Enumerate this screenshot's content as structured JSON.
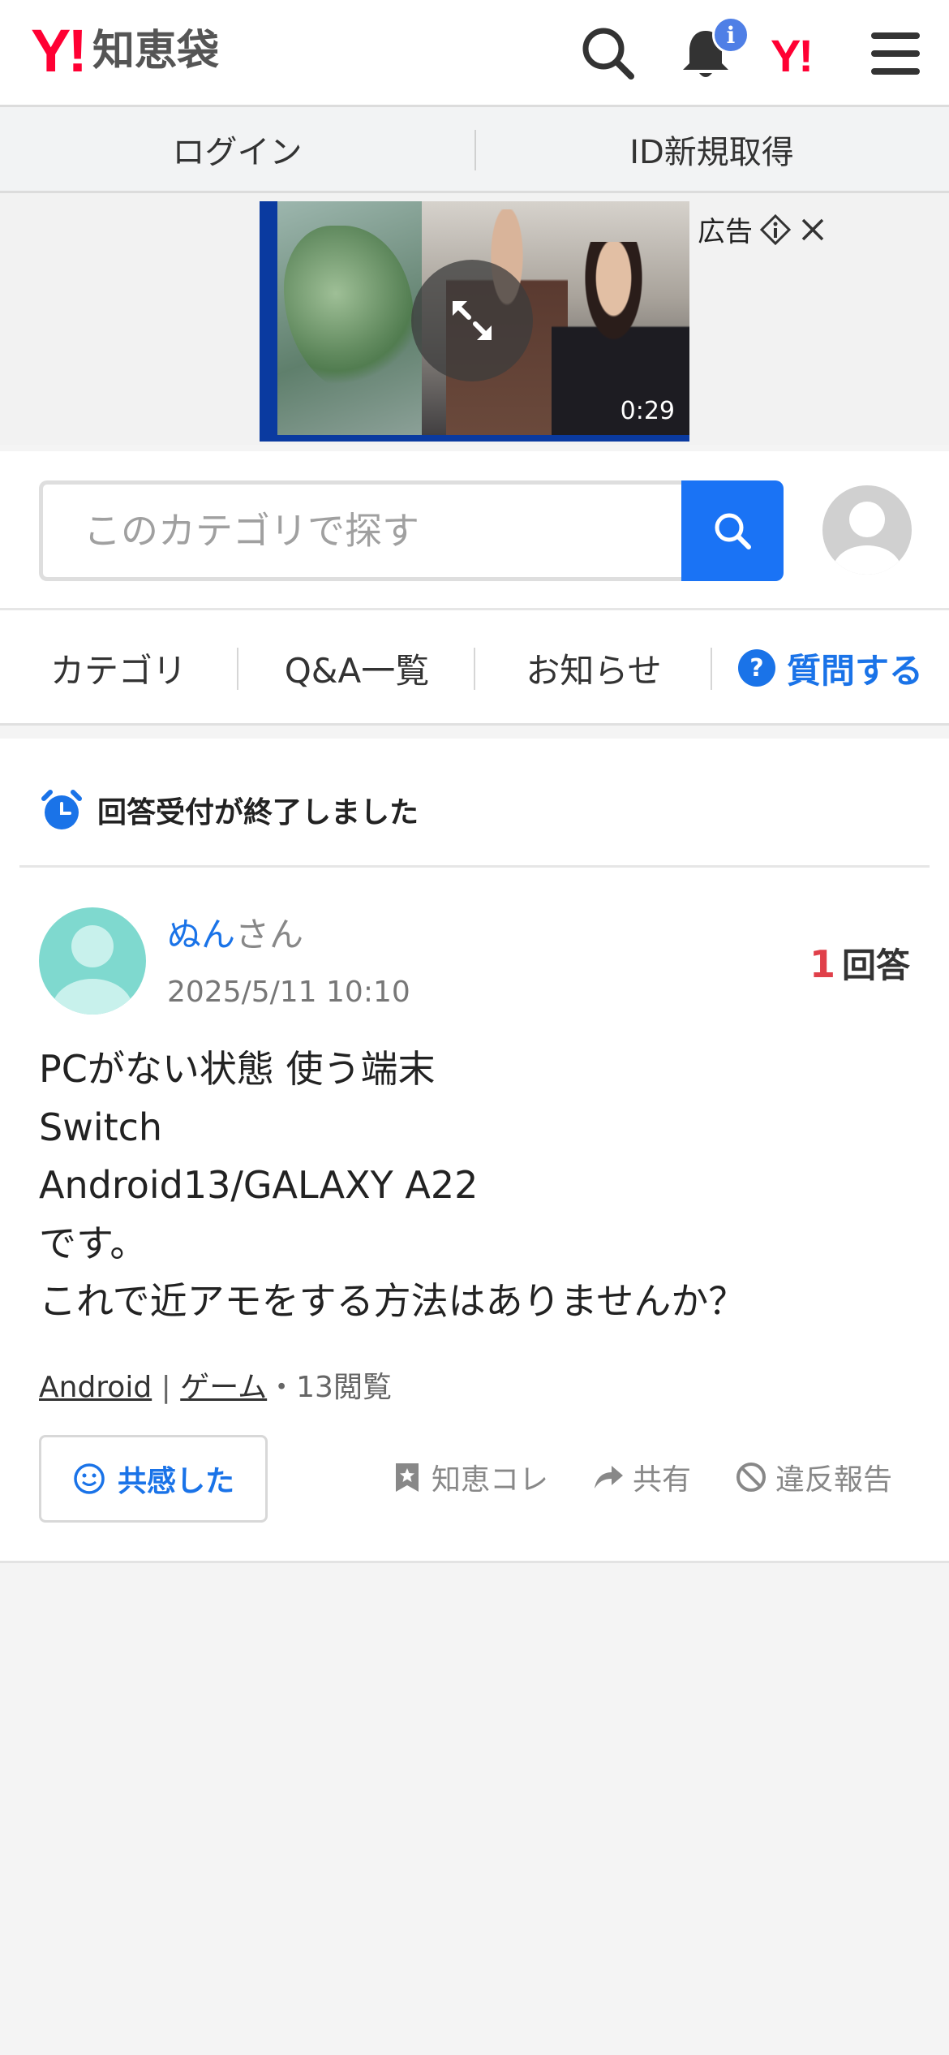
{
  "header": {
    "logo_y": "Y!",
    "logo_text": "知恵袋",
    "notification_badge": "i",
    "small_logo": "Y!",
    "icons": [
      "search-icon",
      "bell-icon",
      "yahoo-logo",
      "menu-icon"
    ]
  },
  "auth": {
    "login_label": "ログイン",
    "signup_label": "ID新規取得"
  },
  "ad": {
    "label": "広告",
    "video_time": "0:29"
  },
  "search": {
    "placeholder": "このカテゴリで探す"
  },
  "nav": {
    "category": "カテゴリ",
    "qa_list": "Q&A一覧",
    "news": "お知らせ",
    "ask": "質問する"
  },
  "question": {
    "closed_notice": "回答受付が終了しました",
    "user_name": "ぬん",
    "user_suffix": "さん",
    "date": "2025/5/11 10:10",
    "answer_count": "1",
    "answer_label": "回答",
    "body_lines": [
      "PCがない状態 使う端末",
      "Switch",
      "Android13/GALAXY A22",
      "です。",
      "これで近アモをする方法はありませんか？"
    ],
    "tag1": "Android",
    "tag_sep": "|",
    "tag2": "ゲーム",
    "views": "・13閲覧",
    "empathy_label": "共感した",
    "collect_label": "知恵コレ",
    "share_label": "共有",
    "report_label": "違反報告"
  },
  "colors": {
    "brand_red": "#ff0033",
    "accent_blue": "#1a73e8",
    "answer_red": "#e0404a"
  }
}
